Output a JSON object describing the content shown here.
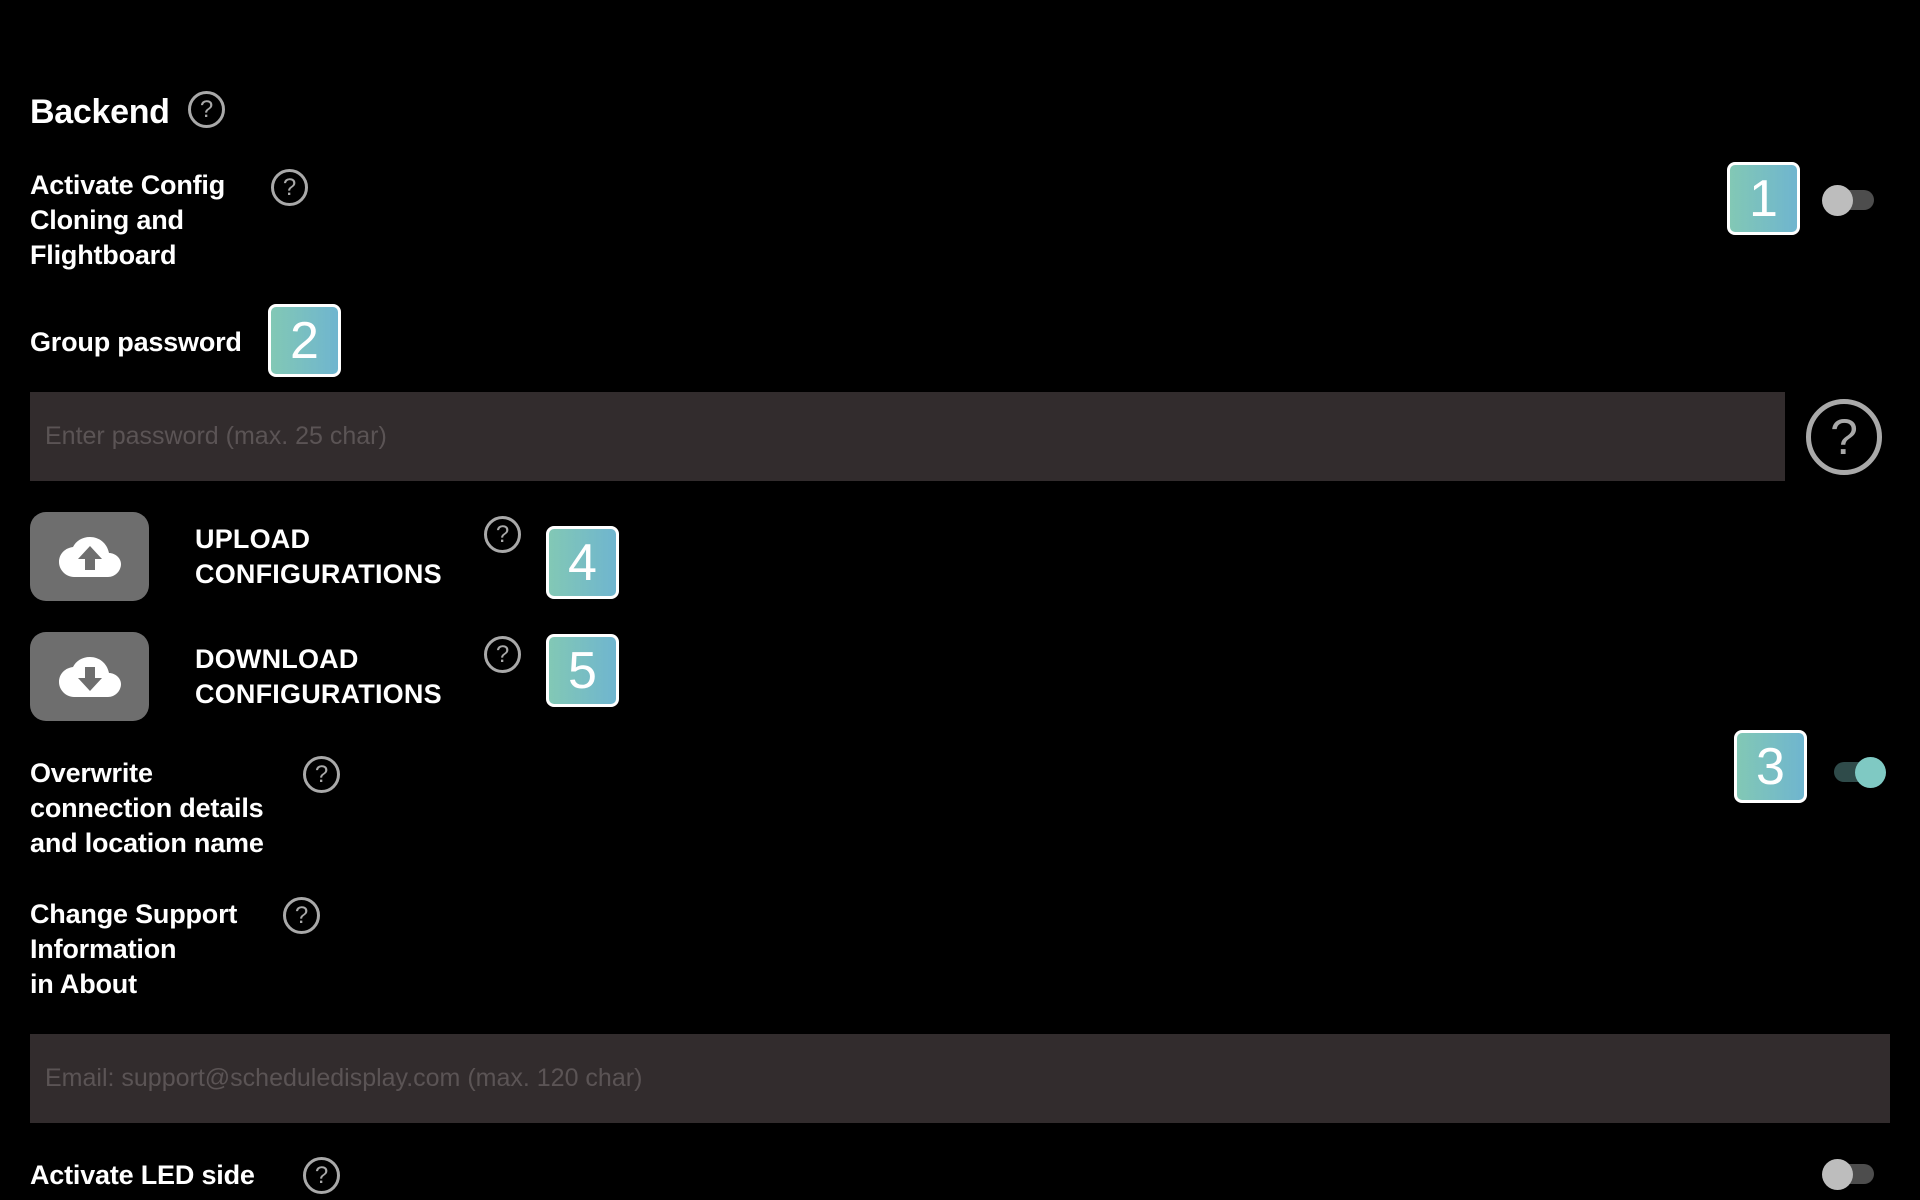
{
  "section": {
    "title": "Backend"
  },
  "settings": {
    "config_cloning": {
      "label": "Activate Config\nCloning and\nFlightboard",
      "badge": "1",
      "enabled": false
    },
    "group_password": {
      "label": "Group password",
      "badge": "2",
      "value": "",
      "placeholder": "Enter password (max. 25 char)"
    },
    "upload": {
      "label": "UPLOAD\nCONFIGURATIONS",
      "badge": "4",
      "icon": "cloud-upload-icon"
    },
    "download": {
      "label": "DOWNLOAD\nCONFIGURATIONS",
      "badge": "5",
      "icon": "cloud-download-icon"
    },
    "overwrite_connection": {
      "label": "Overwrite\nconnection details\nand location name",
      "badge": "3",
      "enabled": true
    },
    "support_info": {
      "label": "Change Support\nInformation\nin About",
      "value": "",
      "placeholder": "Email: support@scheduledisplay.com (max. 120 char)"
    },
    "led_side": {
      "label": "Activate LED side",
      "enabled": false
    }
  },
  "icons": {
    "help": "?"
  },
  "colors": {
    "accent": "#7fc9c3",
    "badge_gradient_start": "#82c8b5",
    "badge_gradient_end": "#6fb5cf",
    "input_bg": "#322c2d",
    "button_bg": "#6e6e6e"
  }
}
